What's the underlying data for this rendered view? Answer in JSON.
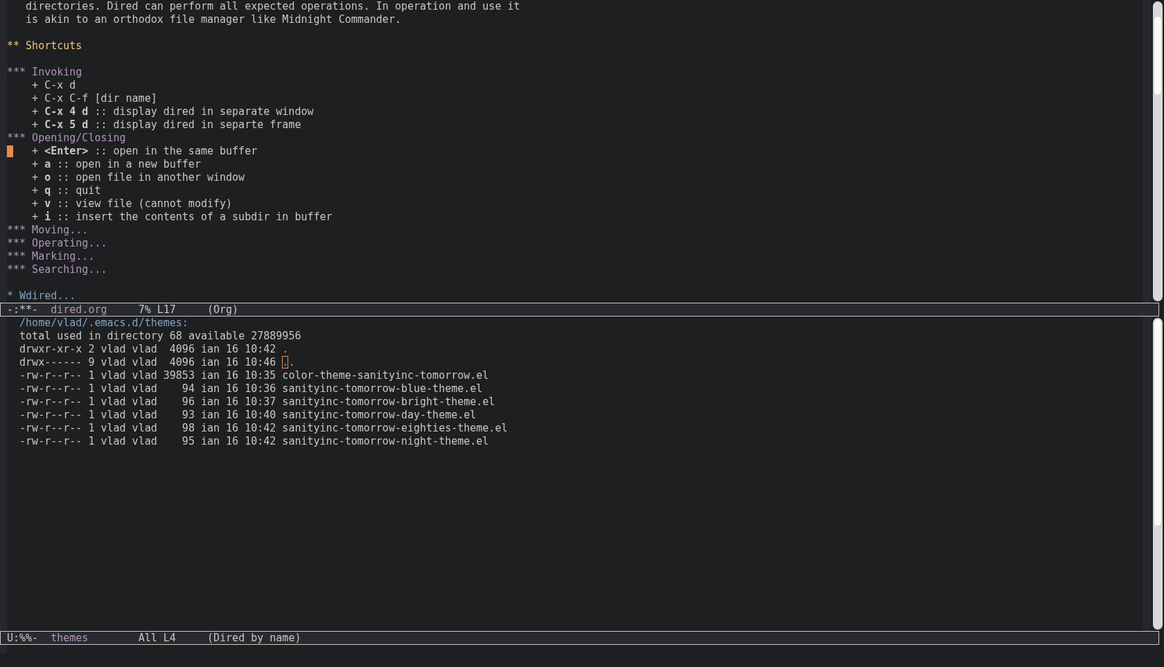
{
  "top_window": {
    "lines": [
      {
        "kind": "text",
        "text": "   directories. Dired can perform all expected operations. In operation and use it"
      },
      {
        "kind": "text",
        "text": "   is akin to an orthodox file manager like Midnight Commander."
      },
      {
        "kind": "blank"
      },
      {
        "kind": "heading2",
        "stars": "**",
        "title": "Shortcuts"
      },
      {
        "kind": "blank"
      },
      {
        "kind": "heading3",
        "stars": "***",
        "title": "Invoking"
      },
      {
        "kind": "item",
        "bullet": "+",
        "text": "C-x d"
      },
      {
        "kind": "item",
        "bullet": "+",
        "text": "C-x C-f [dir name]"
      },
      {
        "kind": "item",
        "bullet": "+",
        "key": "C-x 4 d",
        "sep": "::",
        "text": "display dired in separate window"
      },
      {
        "kind": "item",
        "bullet": "+",
        "key": "C-x 5 d",
        "sep": "::",
        "text": "display dired in separte frame"
      },
      {
        "kind": "heading3",
        "stars": "***",
        "title": "Opening/Closing"
      },
      {
        "kind": "item",
        "bullet": "+",
        "key": "<Enter>",
        "sep": "::",
        "text": "open in the same buffer",
        "cursor": true
      },
      {
        "kind": "item",
        "bullet": "+",
        "key": "a",
        "sep": "::",
        "text": "open in a new buffer"
      },
      {
        "kind": "item",
        "bullet": "+",
        "key": "o",
        "sep": "::",
        "text": "open file in another window"
      },
      {
        "kind": "item",
        "bullet": "+",
        "key": "q",
        "sep": "::",
        "text": "quit"
      },
      {
        "kind": "item",
        "bullet": "+",
        "key": "v",
        "sep": "::",
        "text": "view file (cannot modify)"
      },
      {
        "kind": "item",
        "bullet": "+",
        "key": "i",
        "sep": "::",
        "text": "insert the contents of a subdir in buffer"
      },
      {
        "kind": "heading3",
        "stars": "***",
        "title": "Moving..."
      },
      {
        "kind": "heading3",
        "stars": "***",
        "title": "Operating..."
      },
      {
        "kind": "heading3",
        "stars": "***",
        "title": "Marking..."
      },
      {
        "kind": "heading3",
        "stars": "***",
        "title": "Searching..."
      },
      {
        "kind": "blank"
      },
      {
        "kind": "heading1",
        "stars": "*",
        "title": "Wdired..."
      }
    ]
  },
  "top_mode_line": {
    "flags": "-:**-",
    "buffer": "dired.org",
    "position": "7% L17",
    "mode": "(Org)"
  },
  "bottom_window": {
    "header": "/home/vlad/.emacs.d/themes:",
    "summary": "total used in directory 68 available 27889956",
    "rows": [
      {
        "info": "drwxr-xr-x 2 vlad vlad  4096 ian 16 10:42",
        "name": ".",
        "kind": "directory",
        "cursor": false
      },
      {
        "info": "drwx------ 9 vlad vlad  4096 ian 16 10:46",
        "name": "..",
        "kind": "directory",
        "cursor": true
      },
      {
        "info": "-rw-r--r-- 1 vlad vlad 39853 ian 16 10:35",
        "name": "color-theme-sanityinc-tomorrow.el",
        "kind": "file",
        "cursor": false
      },
      {
        "info": "-rw-r--r-- 1 vlad vlad    94 ian 16 10:36",
        "name": "sanityinc-tomorrow-blue-theme.el",
        "kind": "file",
        "cursor": false
      },
      {
        "info": "-rw-r--r-- 1 vlad vlad    96 ian 16 10:37",
        "name": "sanityinc-tomorrow-bright-theme.el",
        "kind": "file",
        "cursor": false
      },
      {
        "info": "-rw-r--r-- 1 vlad vlad    93 ian 16 10:40",
        "name": "sanityinc-tomorrow-day-theme.el",
        "kind": "file",
        "cursor": false
      },
      {
        "info": "-rw-r--r-- 1 vlad vlad    98 ian 16 10:42",
        "name": "sanityinc-tomorrow-eighties-theme.el",
        "kind": "file",
        "cursor": false
      },
      {
        "info": "-rw-r--r-- 1 vlad vlad    95 ian 16 10:42",
        "name": "sanityinc-tomorrow-night-theme.el",
        "kind": "file",
        "cursor": false
      }
    ]
  },
  "bottom_mode_line": {
    "flags": "U:%%-",
    "buffer": "themes",
    "position": "All L4",
    "mode": "(Dired by name)"
  }
}
